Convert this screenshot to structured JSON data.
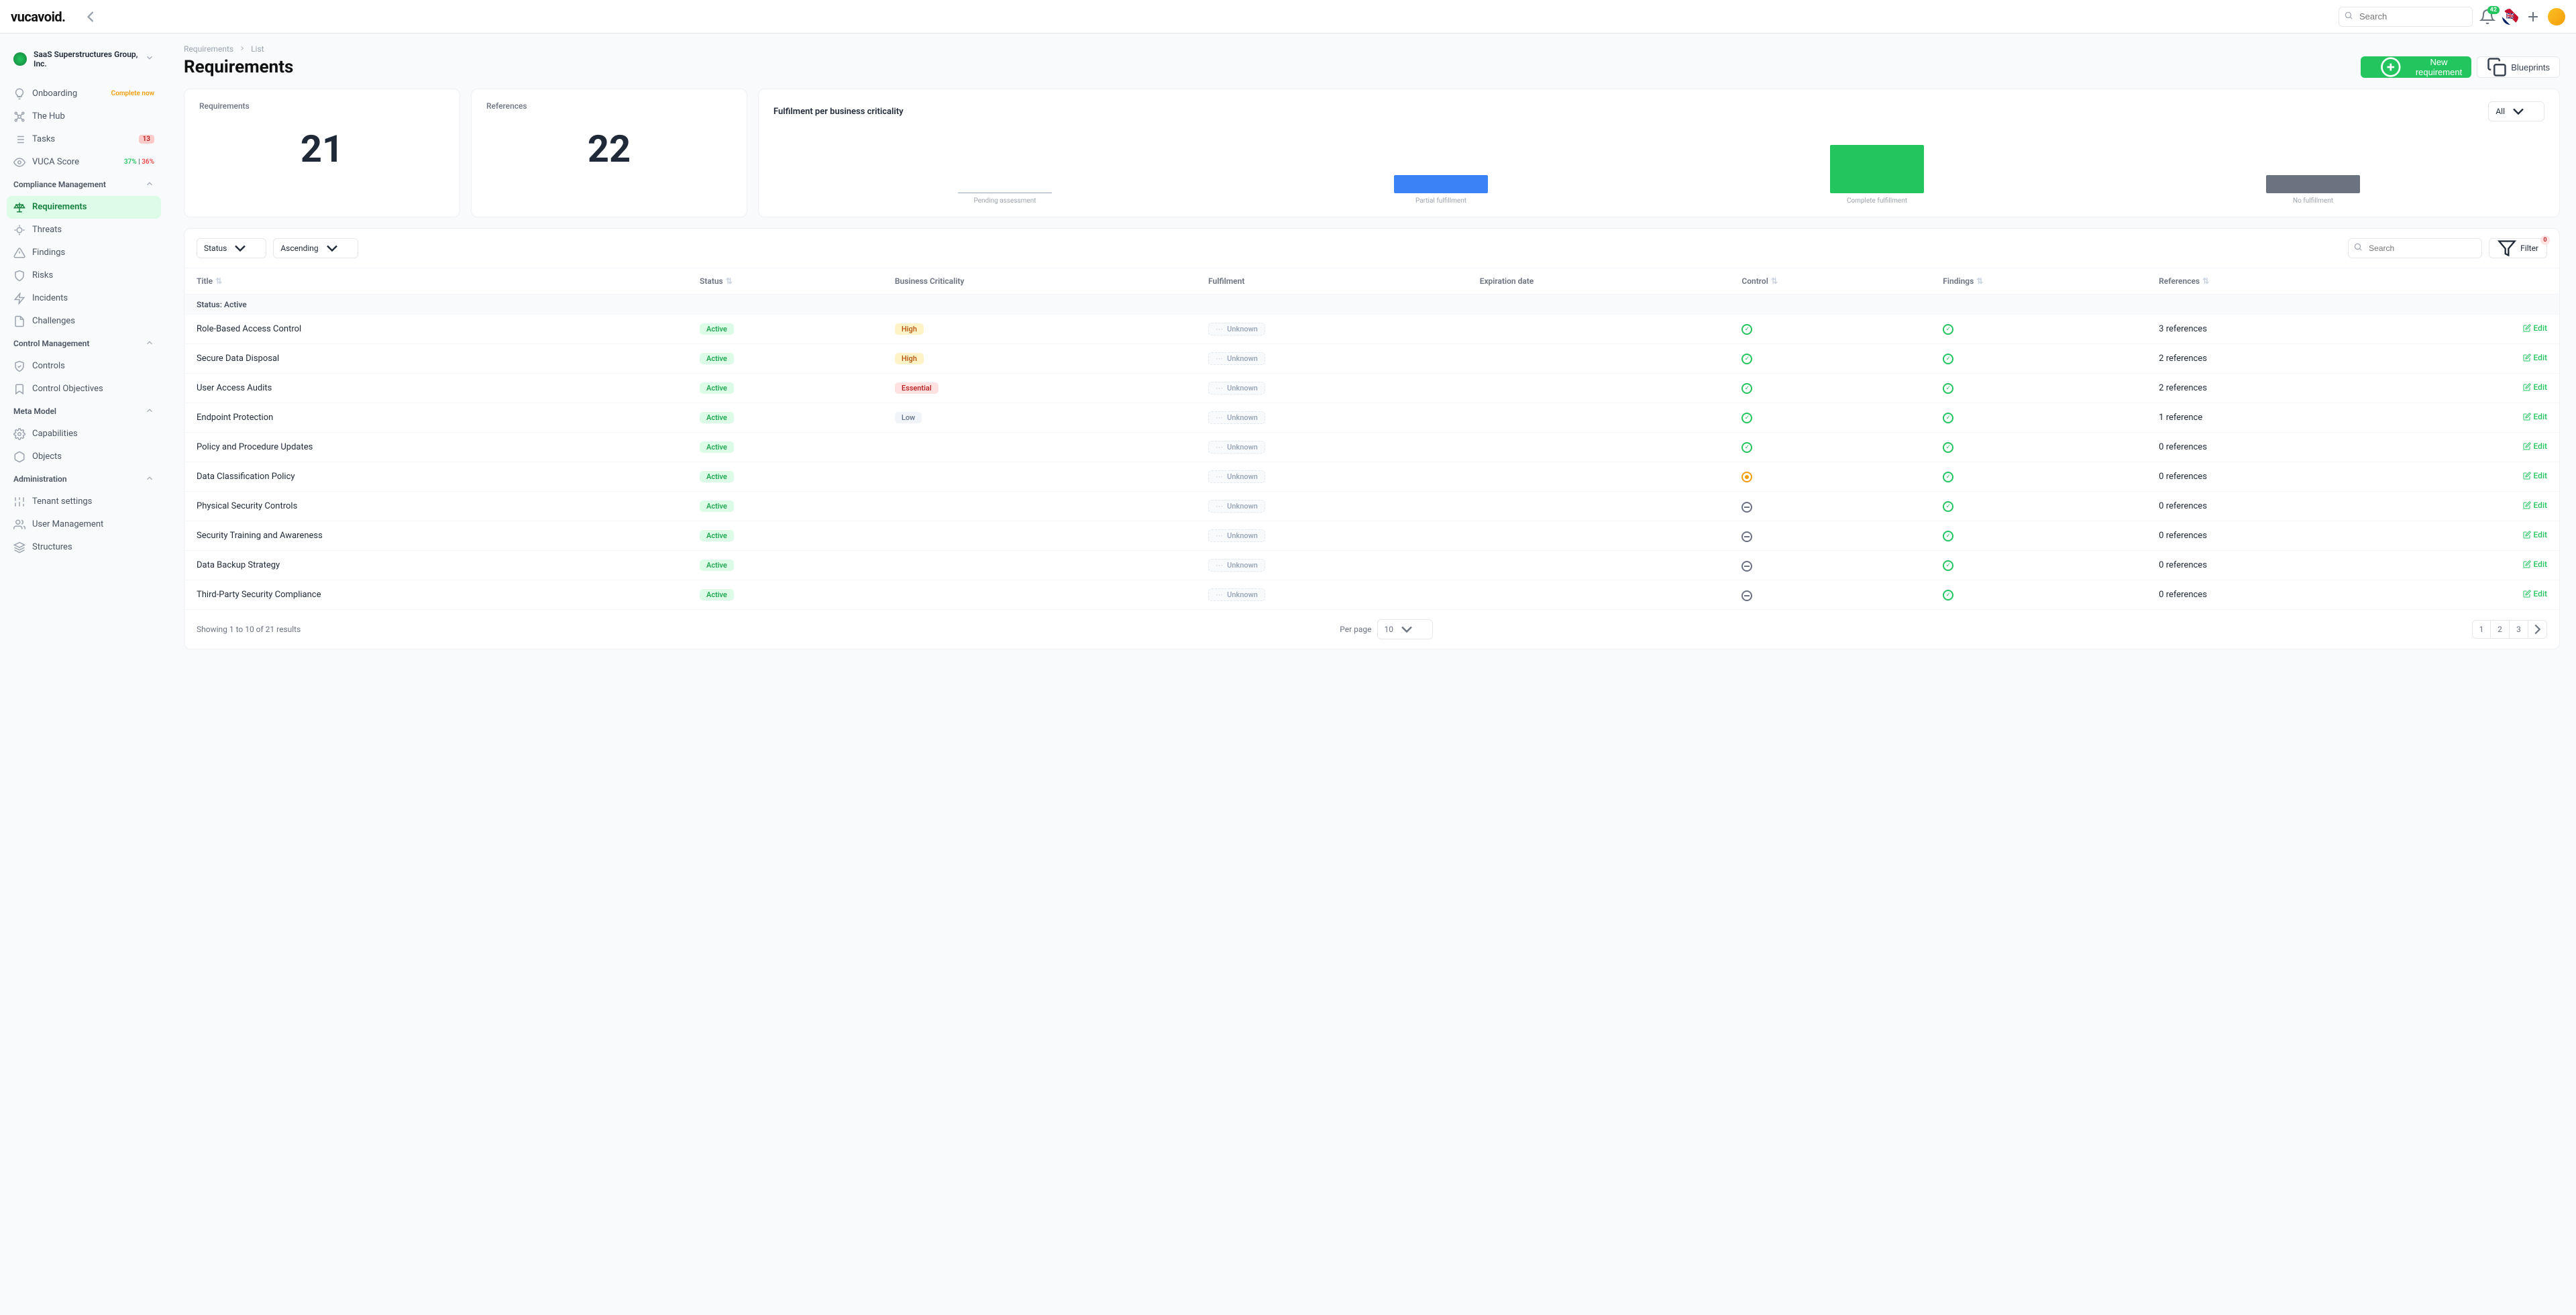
{
  "brand": "vucavoid",
  "search": {
    "placeholder": "Search"
  },
  "notif_count": "42",
  "tenant": {
    "name": "SaaS Superstructures Group, Inc."
  },
  "nav": {
    "onboarding": "Onboarding",
    "onboarding_tag": "Complete now",
    "hub": "The Hub",
    "tasks": "Tasks",
    "tasks_badge": "13",
    "vuca": "VUCA Score",
    "vuca_score_g": "37%",
    "vuca_score_r": "36%",
    "compliance": "Compliance Management",
    "requirements": "Requirements",
    "threats": "Threats",
    "findings": "Findings",
    "risks": "Risks",
    "incidents": "Incidents",
    "challenges": "Challenges",
    "control_mgmt": "Control Management",
    "controls": "Controls",
    "control_obj": "Control Objectives",
    "meta": "Meta Model",
    "capabilities": "Capabilities",
    "objects": "Objects",
    "admin": "Administration",
    "tenant_settings": "Tenant settings",
    "user_mgmt": "User Management",
    "structures": "Structures"
  },
  "breadcrumb": {
    "a": "Requirements",
    "b": "List"
  },
  "page_title": "Requirements",
  "actions": {
    "new": "New requirement",
    "blueprints": "Blueprints"
  },
  "stats": {
    "req_label": "Requirements",
    "req_value": "21",
    "ref_label": "References",
    "ref_value": "22",
    "chart_title": "Fulfilment per business criticality",
    "chart_all": "All"
  },
  "chart_data": {
    "type": "bar",
    "categories": [
      "Pending assessment",
      "Partial fulfillment",
      "Complete fulfillment",
      "No fulfillment"
    ],
    "values": [
      0,
      30,
      80,
      30
    ],
    "colors": [
      "#94a3b8",
      "#3b82f6",
      "#22c55e",
      "#6b7280"
    ],
    "ylim": [
      0,
      100
    ]
  },
  "toolbar": {
    "sort_field": "Status",
    "sort_dir": "Ascending",
    "search_placeholder": "Search",
    "filter": "Filter",
    "filter_count": "0"
  },
  "columns": {
    "title": "Title",
    "status": "Status",
    "criticality": "Business Criticality",
    "fulfilment": "Fulfilment",
    "expiration": "Expiration date",
    "control": "Control",
    "findings": "Findings",
    "references": "References"
  },
  "group": "Status: Active",
  "rows": [
    {
      "title": "Role-Based Access Control",
      "status": "Active",
      "crit": "High",
      "fulfil": "Unknown",
      "control": "check",
      "findings": "check",
      "refs": "3 references"
    },
    {
      "title": "Secure Data Disposal",
      "status": "Active",
      "crit": "High",
      "fulfil": "Unknown",
      "control": "check",
      "findings": "check",
      "refs": "2 references"
    },
    {
      "title": "User Access Audits",
      "status": "Active",
      "crit": "Essential",
      "fulfil": "Unknown",
      "control": "check",
      "findings": "check",
      "refs": "2 references"
    },
    {
      "title": "Endpoint Protection",
      "status": "Active",
      "crit": "Low",
      "fulfil": "Unknown",
      "control": "check",
      "findings": "check",
      "refs": "1 reference"
    },
    {
      "title": "Policy and Procedure Updates",
      "status": "Active",
      "crit": "",
      "fulfil": "Unknown",
      "control": "check",
      "findings": "check",
      "refs": "0 references"
    },
    {
      "title": "Data Classification Policy",
      "status": "Active",
      "crit": "",
      "fulfil": "Unknown",
      "control": "warn",
      "findings": "check",
      "refs": "0 references"
    },
    {
      "title": "Physical Security Controls",
      "status": "Active",
      "crit": "",
      "fulfil": "Unknown",
      "control": "dash",
      "findings": "check",
      "refs": "0 references"
    },
    {
      "title": "Security Training and Awareness",
      "status": "Active",
      "crit": "",
      "fulfil": "Unknown",
      "control": "dash",
      "findings": "check",
      "refs": "0 references"
    },
    {
      "title": "Data Backup Strategy",
      "status": "Active",
      "crit": "",
      "fulfil": "Unknown",
      "control": "dash",
      "findings": "check",
      "refs": "0 references"
    },
    {
      "title": "Third-Party Security Compliance",
      "status": "Active",
      "crit": "",
      "fulfil": "Unknown",
      "control": "dash",
      "findings": "check",
      "refs": "0 references"
    }
  ],
  "edit": "Edit",
  "footer": {
    "showing": "Showing 1 to 10 of 21 results",
    "per_page_label": "Per page",
    "per_page": "10",
    "pages": [
      "1",
      "2",
      "3"
    ]
  }
}
